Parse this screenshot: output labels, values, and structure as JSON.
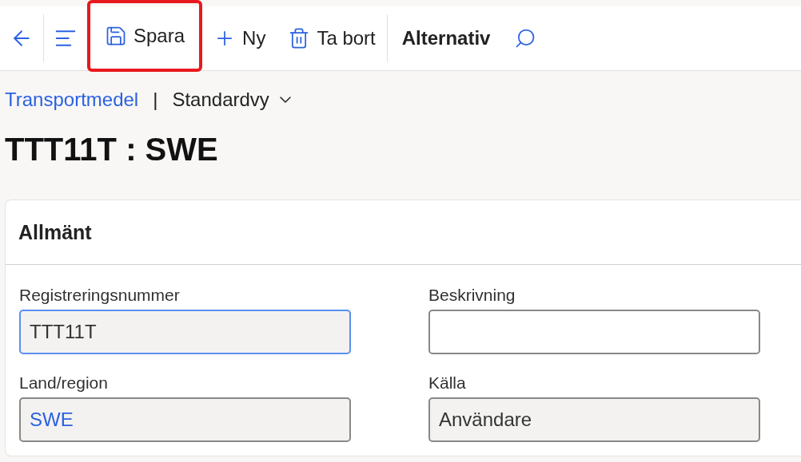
{
  "toolbar": {
    "actions": [
      {
        "label": "Spara",
        "highlighted": true
      },
      {
        "label": "Ny",
        "highlighted": false
      },
      {
        "label": "Ta bort",
        "highlighted": false
      }
    ],
    "options_label": "Alternativ"
  },
  "breadcrumb": {
    "link": "Transportmedel",
    "separator": "|",
    "view": "Standardvy"
  },
  "title": "TTT11T : SWE",
  "section": {
    "title": "Allmänt",
    "fields": [
      {
        "label": "Registreringsnummer",
        "value": "TTT11T",
        "focused": true,
        "readonly": true,
        "link": false
      },
      {
        "label": "Beskrivning",
        "focused": false,
        "readonly": false
      },
      {
        "label": "Land/region",
        "value": "SWE",
        "focused": false,
        "readonly": true,
        "link": true
      },
      {
        "label": "Källa",
        "value": "Användare",
        "focused": false,
        "readonly": true,
        "link": false
      }
    ]
  }
}
